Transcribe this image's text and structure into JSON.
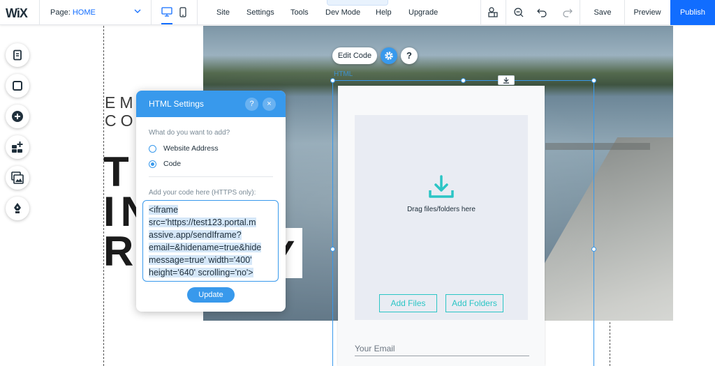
{
  "app": {
    "logo": "WiX"
  },
  "topbar": {
    "page_label": "Page:",
    "page_value": "HOME",
    "menu": [
      "Site",
      "Settings",
      "Tools",
      "Dev Mode",
      "Help",
      "Upgrade"
    ],
    "save_label": "Save",
    "preview_label": "Preview",
    "publish_label": "Publish"
  },
  "icons": {
    "desktop": "desktop-icon",
    "mobile": "mobile-icon",
    "layers": "layers-icon",
    "zoom": "zoom-out-icon",
    "undo": "undo-icon",
    "redo": "redo-icon",
    "gear": "gear-icon",
    "help": "help-icon",
    "close": "close-icon",
    "download": "download-icon"
  },
  "left_rail": [
    "pages-icon",
    "background-icon",
    "add-icon",
    "apps-icon",
    "media-icon",
    "blog-icon"
  ],
  "site_text": {
    "line1": "EM",
    "line2": "CO",
    "big1": "T",
    "big2": "IN",
    "big3": "R",
    "big_tail": "Y"
  },
  "element_toolbar": {
    "edit_code": "Edit Code",
    "help": "?",
    "tag": "HTML"
  },
  "upload_widget": {
    "drop_label": "Drag files/folders here",
    "add_files": "Add Files",
    "add_folders": "Add Folders",
    "email_placeholder": "Your Email",
    "accent": "#2bc5c5"
  },
  "panel": {
    "title": "HTML Settings",
    "help": "?",
    "close": "×",
    "question": "What do you want to add?",
    "options": [
      {
        "label": "Website Address",
        "selected": false
      },
      {
        "label": "Code",
        "selected": true
      }
    ],
    "code_label": "Add your code here (HTTPS only):",
    "code_lines": [
      "<iframe",
      "src='https://test123.portal.m",
      "assive.app/sendIframe?",
      "email=&hidename=true&hide",
      "message=true' width='400'",
      "height='640' scrolling='no'>"
    ],
    "update_label": "Update"
  },
  "colors": {
    "brand_blue": "#116dff",
    "panel_blue": "#3899ec",
    "teal": "#2bc5c5"
  }
}
